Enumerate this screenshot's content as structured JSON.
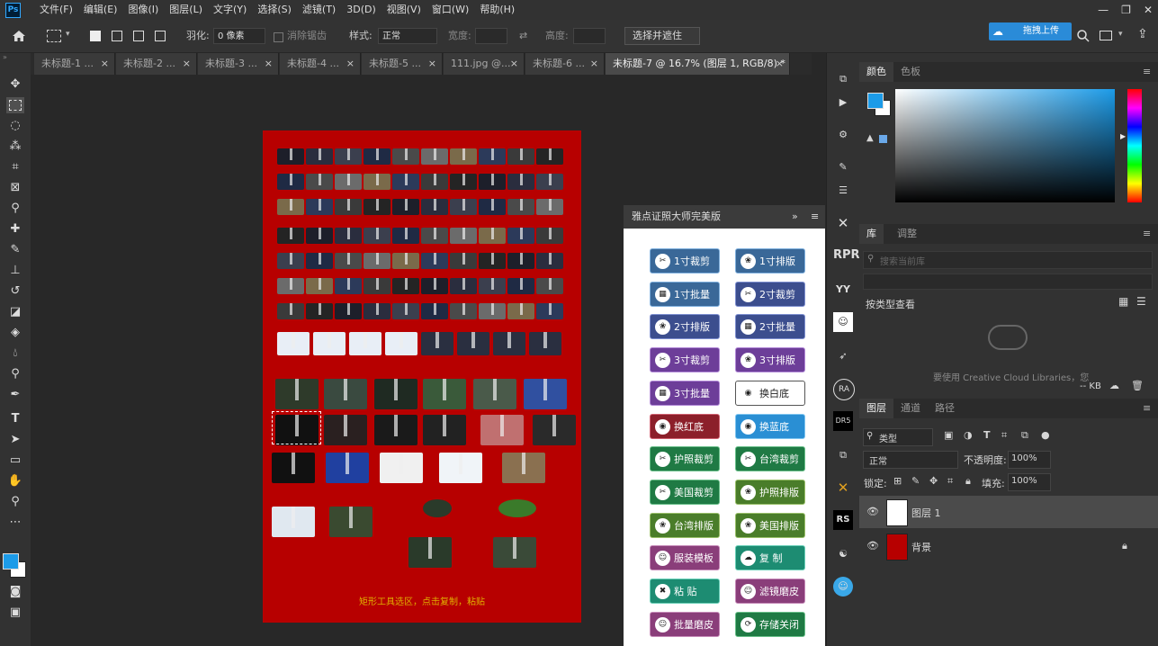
{
  "menubar": {
    "logo": "Ps",
    "items": [
      "文件(F)",
      "编辑(E)",
      "图像(I)",
      "图层(L)",
      "文字(Y)",
      "选择(S)",
      "滤镜(T)",
      "3D(D)",
      "视图(V)",
      "窗口(W)",
      "帮助(H)"
    ],
    "window_controls": [
      "—",
      "❐",
      "✕"
    ]
  },
  "options": {
    "feather_label": "羽化:",
    "feather_value": "0 像素",
    "antialias_label": "消除锯齿",
    "style_label": "样式:",
    "style_value": "正常",
    "width_label": "宽度:",
    "height_label": "高度:",
    "select_mask_button": "选择并遮住 ...",
    "upload_button": "拖拽上传"
  },
  "tabs": [
    {
      "label": "未标题-1 ...",
      "active": false
    },
    {
      "label": "未标题-2 ...",
      "active": false
    },
    {
      "label": "未标题-3 ...",
      "active": false
    },
    {
      "label": "未标题-4 ...",
      "active": false
    },
    {
      "label": "未标题-5 ...",
      "active": false
    },
    {
      "label": "111.jpg @...",
      "active": false
    },
    {
      "label": "未标题-6 ...",
      "active": false
    },
    {
      "label": "未标题-7 @ 16.7% (图层 1, RGB/8) *",
      "active": true
    }
  ],
  "document": {
    "caption": "矩形工具选区，点击复制，粘贴"
  },
  "plugin": {
    "title": "雅点证照大师完美版",
    "buttons": [
      {
        "label": "1寸裁剪",
        "style": "blue",
        "icon": "✂"
      },
      {
        "label": "1寸排版",
        "style": "blue",
        "icon": "❀"
      },
      {
        "label": "1寸批量",
        "style": "blue",
        "icon": "▦"
      },
      {
        "label": "2寸裁剪",
        "style": "navy",
        "icon": "✂"
      },
      {
        "label": "2寸排版",
        "style": "navy",
        "icon": "❀"
      },
      {
        "label": "2寸批量",
        "style": "navy",
        "icon": "▦"
      },
      {
        "label": "3寸裁剪",
        "style": "purple",
        "icon": "✂"
      },
      {
        "label": "3寸排版",
        "style": "purple",
        "icon": "❀"
      },
      {
        "label": "3寸批量",
        "style": "purple",
        "icon": "▦"
      },
      {
        "label": "换白底",
        "style": "white",
        "icon": "◉"
      },
      {
        "label": "换红底",
        "style": "red",
        "icon": "◉"
      },
      {
        "label": "换蓝底",
        "style": "sky",
        "icon": "◉"
      },
      {
        "label": "护照裁剪",
        "style": "green",
        "icon": "✂"
      },
      {
        "label": "台湾裁剪",
        "style": "green",
        "icon": "✂"
      },
      {
        "label": "美国裁剪",
        "style": "green",
        "icon": "✂"
      },
      {
        "label": "护照排版",
        "style": "olive",
        "icon": "❀"
      },
      {
        "label": "台湾排版",
        "style": "olive",
        "icon": "❀"
      },
      {
        "label": "美国排版",
        "style": "olive",
        "icon": "❀"
      },
      {
        "label": "服装模板",
        "style": "mauve",
        "icon": "☺"
      },
      {
        "label": "复  制",
        "style": "teal",
        "icon": "☁"
      },
      {
        "label": "粘  贴",
        "style": "teal",
        "icon": "✖"
      },
      {
        "label": "滤镜磨皮",
        "style": "mauve",
        "icon": "☺"
      },
      {
        "label": "批量磨皮",
        "style": "mauve",
        "icon": "☺"
      },
      {
        "label": "存储关闭",
        "style": "green",
        "icon": "⟳"
      }
    ]
  },
  "strip_icons": [
    "TE",
    "RPRO",
    "YY",
    "RA",
    "DR5",
    "RS"
  ],
  "panels": {
    "color_tabs": [
      "颜色",
      "色板"
    ],
    "library_tabs": [
      "库",
      "调整"
    ],
    "library_search_placeholder": "搜索当前库",
    "library_view_label": "按类型查看",
    "library_message": "要使用 Creative Cloud Libraries，您",
    "library_size": "-- KB",
    "layers_tabs": [
      "图层",
      "通道",
      "路径"
    ],
    "layers_filter": "类型",
    "blend_mode": "正常",
    "opacity_label": "不透明度:",
    "opacity_value": "100%",
    "lock_label": "锁定:",
    "fill_label": "填充:",
    "fill_value": "100%",
    "layers": [
      {
        "name": "图层 1",
        "selected": true
      },
      {
        "name": "背景",
        "selected": false
      }
    ]
  },
  "colors": {
    "document_bg": "#b70000",
    "accent": "#31a8ff",
    "foreground": "#1c9be8"
  }
}
